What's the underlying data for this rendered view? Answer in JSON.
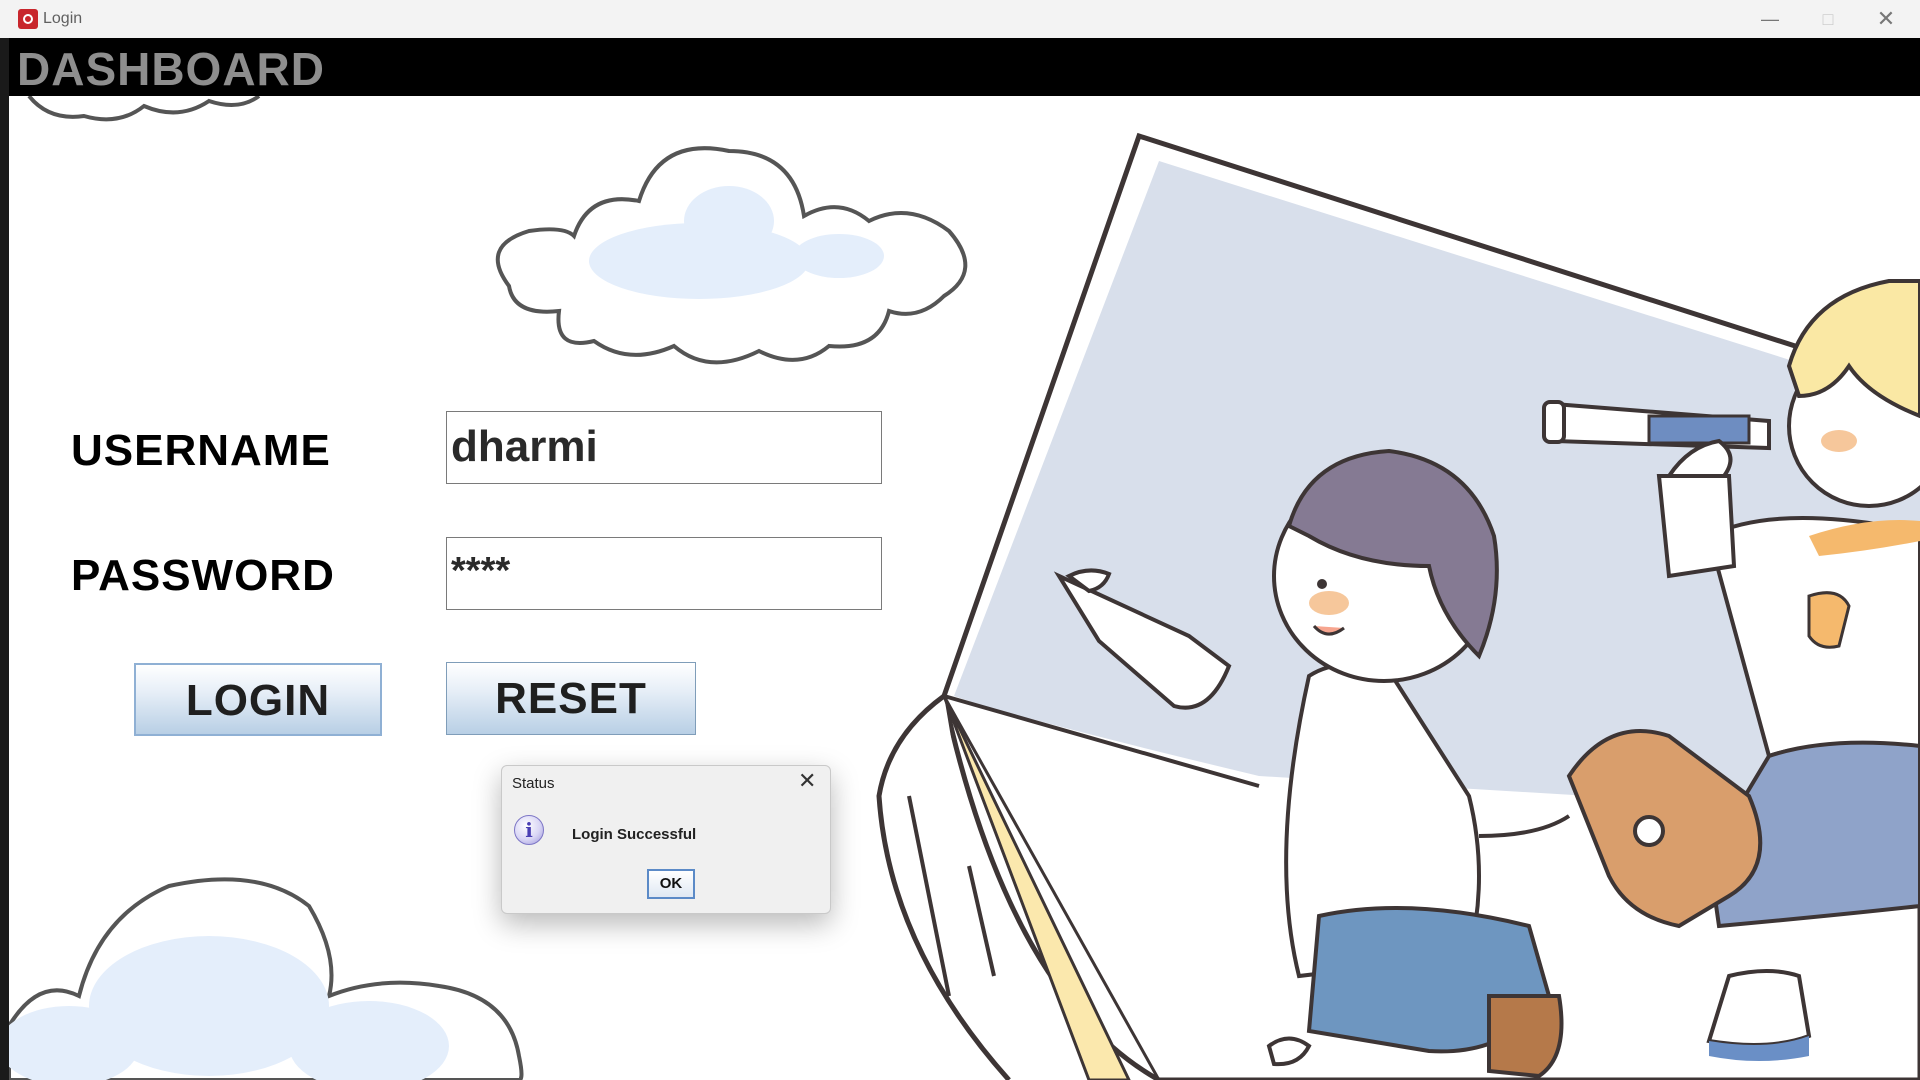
{
  "window": {
    "title": "Login"
  },
  "header": {
    "title": "DASHBOARD"
  },
  "form": {
    "username_label": "USERNAME",
    "username_value": "dharmi",
    "password_label": "PASSWORD",
    "password_value": "****",
    "login_label": "LOGIN",
    "reset_label": "RESET"
  },
  "dialog": {
    "title": "Status",
    "message": "Login Successful",
    "ok_label": "OK",
    "icon": "info-icon"
  },
  "icons": {
    "app": "app-icon",
    "minimize": "minimize-icon",
    "maximize": "maximize-icon",
    "close": "close-icon"
  },
  "colors": {
    "header_bg": "#000000",
    "header_text": "#8e8e8e",
    "button_gradient_bottom": "#b8cfe5"
  }
}
